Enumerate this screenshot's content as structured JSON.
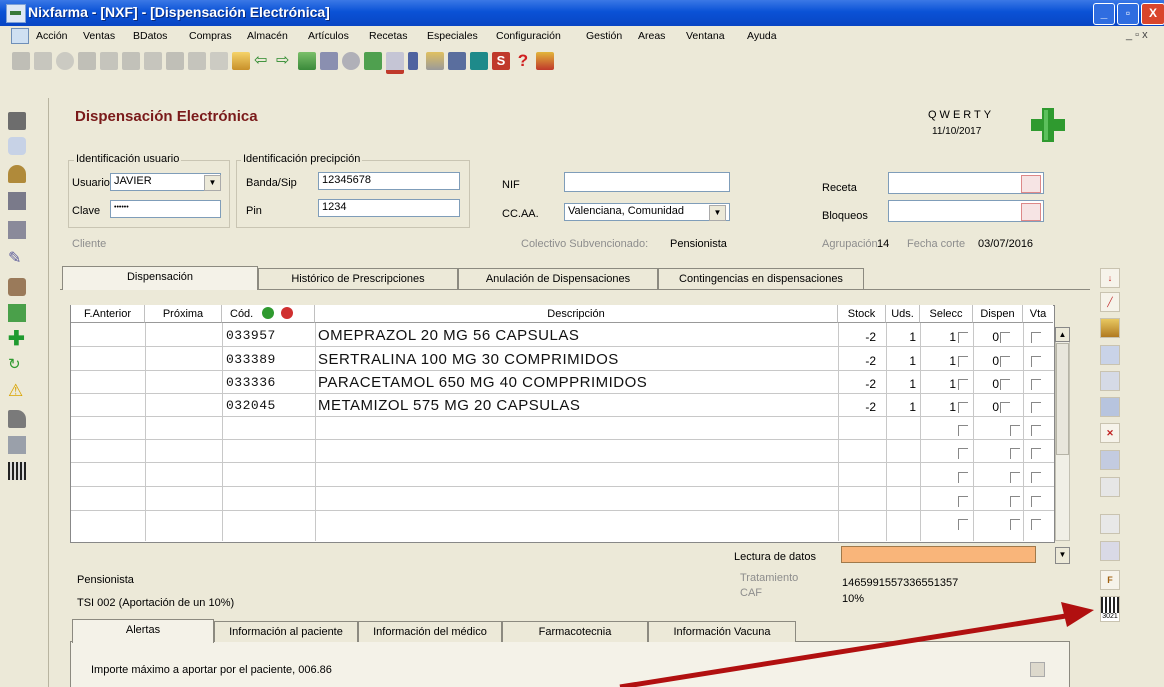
{
  "window": {
    "title": "Nixfarma - [NXF] - [Dispensación Electrónica]",
    "btn_min": "_",
    "btn_max": "▫",
    "btn_close": "X",
    "mdi_controls": "_ ▫ x"
  },
  "menu": {
    "items": [
      "Acción",
      "Ventas",
      "BDatos",
      "Compras",
      "Almacén",
      "Artículos",
      "Recetas",
      "Especiales",
      "Configuración",
      "Gestión",
      "Areas",
      "Ventana",
      "Ayuda"
    ]
  },
  "toolbar": {
    "help_glyph": "?",
    "s_glyph": "S"
  },
  "header": {
    "title": "Dispensación Electrónica",
    "user_code": "QWERTY",
    "date": "11/10/2017"
  },
  "user_id": {
    "caption": "Identificación usuario",
    "usuario_label": "Usuario",
    "usuario_value": "JAVIER",
    "clave_label": "Clave",
    "clave_value": "••••••"
  },
  "prescription_id": {
    "caption": "Identificación precipción",
    "banda_label": "Banda/Sip",
    "banda_value": "12345678",
    "pin_label": "Pin",
    "pin_value": "1234"
  },
  "nif": {
    "label": "NIF",
    "value": ""
  },
  "ccaa": {
    "label": "CC.AA.",
    "value": "Valenciana, Comunidad"
  },
  "receta": {
    "label": "Receta",
    "value": ""
  },
  "bloqueos": {
    "label": "Bloqueos",
    "value": ""
  },
  "info_line": {
    "cliente": "Cliente",
    "colectivo_label": "Colectivo Subvencionado:",
    "colectivo_value": "Pensionista",
    "agrupacion_label": "Agrupación",
    "agrupacion_value": "14",
    "fecha_label": "Fecha corte",
    "fecha_value": "03/07/2016"
  },
  "tabs": [
    {
      "label": "Dispensación",
      "active": true
    },
    {
      "label": "Histórico de Prescripciones",
      "active": false
    },
    {
      "label": "Anulación de Dispensaciones",
      "active": false
    },
    {
      "label": "Contingencias en dispensaciones",
      "active": false
    }
  ],
  "grid": {
    "columns": [
      "F.Anterior",
      "Próxima",
      "Cód.",
      "Descripción",
      "Stock",
      "Uds.",
      "Selecc",
      "Dispen",
      "Vta"
    ],
    "rows": [
      {
        "f_anterior": "",
        "proxima": "",
        "code": "033957",
        "description": "OMEPRAZOL 20 MG 56 CAPSULAS",
        "stock": "-2",
        "uds": "1",
        "selecc": "1",
        "dispen": "0"
      },
      {
        "f_anterior": "",
        "proxima": "",
        "code": "033389",
        "description": "SERTRALINA 100 MG 30 COMPRIMIDOS",
        "stock": "-2",
        "uds": "1",
        "selecc": "1",
        "dispen": "0"
      },
      {
        "f_anterior": "",
        "proxima": "",
        "code": "033336",
        "description": "PARACETAMOL 650 MG 40 COMPPRIMIDOS",
        "stock": "-2",
        "uds": "1",
        "selecc": "1",
        "dispen": "0"
      },
      {
        "f_anterior": "",
        "proxima": "",
        "code": "032045",
        "description": "METAMIZOL 575 MG 20 CAPSULAS",
        "stock": "-2",
        "uds": "1",
        "selecc": "1",
        "dispen": "0"
      }
    ],
    "empty_rows": 5
  },
  "lower": {
    "lectura_label": "Lectura de datos",
    "lectura_value": "",
    "tratamiento_label": "Tratamiento",
    "tratamiento_value": "1465991557336551357",
    "caf_label": "CAF",
    "caf_value": "10%",
    "pensionista": "Pensionista",
    "tsi": "TSI 002 (Aportación de un 10%)"
  },
  "bottom_tabs": [
    {
      "label": "Alertas",
      "active": true
    },
    {
      "label": "Información al paciente",
      "active": false
    },
    {
      "label": "Información del médico",
      "active": false
    },
    {
      "label": "Farmacotecnia",
      "active": false
    },
    {
      "label": "Información Vacuna",
      "active": false
    }
  ],
  "alert": {
    "text": "Importe máximo a aportar por el paciente, 006.86"
  },
  "right_sidebar": {
    "barcode_label": "3021",
    "f_label": "F"
  },
  "colors": {
    "titlebar": "#0a52d6",
    "title_text": "#7a1a1a",
    "cross": "#2f9a2f",
    "arrow": "#b11010",
    "lectura_field": "#f9b57a"
  }
}
